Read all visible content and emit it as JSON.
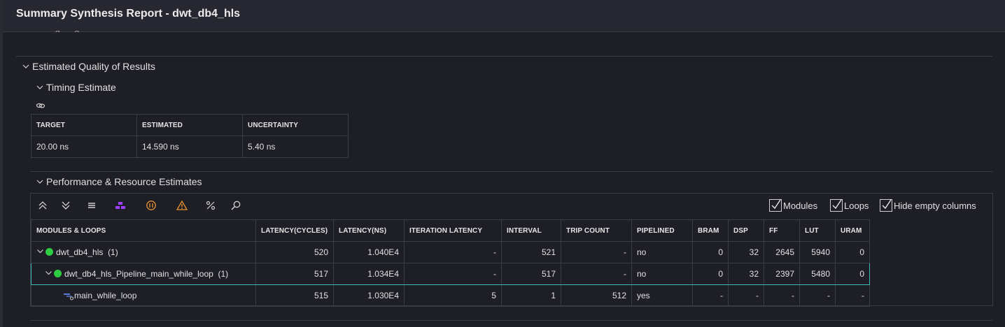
{
  "window": {
    "title": "Summary Synthesis Report - dwt_db4_hls"
  },
  "top_partial_text": "— g — g",
  "sections": {
    "quality": "Estimated Quality of Results",
    "timing": "Timing Estimate",
    "perf": "Performance & Resource Estimates"
  },
  "timing": {
    "headers": [
      "TARGET",
      "ESTIMATED",
      "UNCERTAINTY"
    ],
    "values": [
      "20.00 ns",
      "14.590 ns",
      "5.40 ns"
    ]
  },
  "toolbar": {
    "icons": [
      "collapse-all-icon",
      "expand-all-icon",
      "list-icon",
      "hierarchy-icon",
      "pipeline-icon",
      "warning-icon",
      "percent-icon",
      "search-icon"
    ],
    "checkboxes": [
      {
        "label": "Modules",
        "checked": true
      },
      {
        "label": "Loops",
        "checked": true
      },
      {
        "label": "Hide empty columns",
        "checked": true
      }
    ]
  },
  "perf": {
    "headers": [
      "MODULES & LOOPS",
      "LATENCY(CYCLES)",
      "LATENCY(NS)",
      "ITERATION LATENCY",
      "INTERVAL",
      "TRIP COUNT",
      "PIPELINED",
      "BRAM",
      "DSP",
      "FF",
      "LUT",
      "URAM"
    ],
    "rows": [
      {
        "name": "dwt_db4_hls",
        "count": "(1)",
        "values": [
          "520",
          "1.040E4",
          "-",
          "521",
          "-",
          "no",
          "0",
          "32",
          "2645",
          "5940",
          "0"
        ]
      },
      {
        "name": "dwt_db4_hls_Pipeline_main_while_loop",
        "count": "(1)",
        "values": [
          "517",
          "1.034E4",
          "-",
          "517",
          "-",
          "no",
          "0",
          "32",
          "2397",
          "5480",
          "0"
        ]
      },
      {
        "name": "main_while_loop",
        "count": "",
        "values": [
          "515",
          "1.030E4",
          "5",
          "1",
          "512",
          "yes",
          "-",
          "-",
          "-",
          "-",
          "-"
        ]
      }
    ]
  },
  "colors": {
    "status_ok": "#2ecc40",
    "selection": "#3fb8b2",
    "hierarchy": "#a040ff",
    "warning": "#e8932a"
  }
}
